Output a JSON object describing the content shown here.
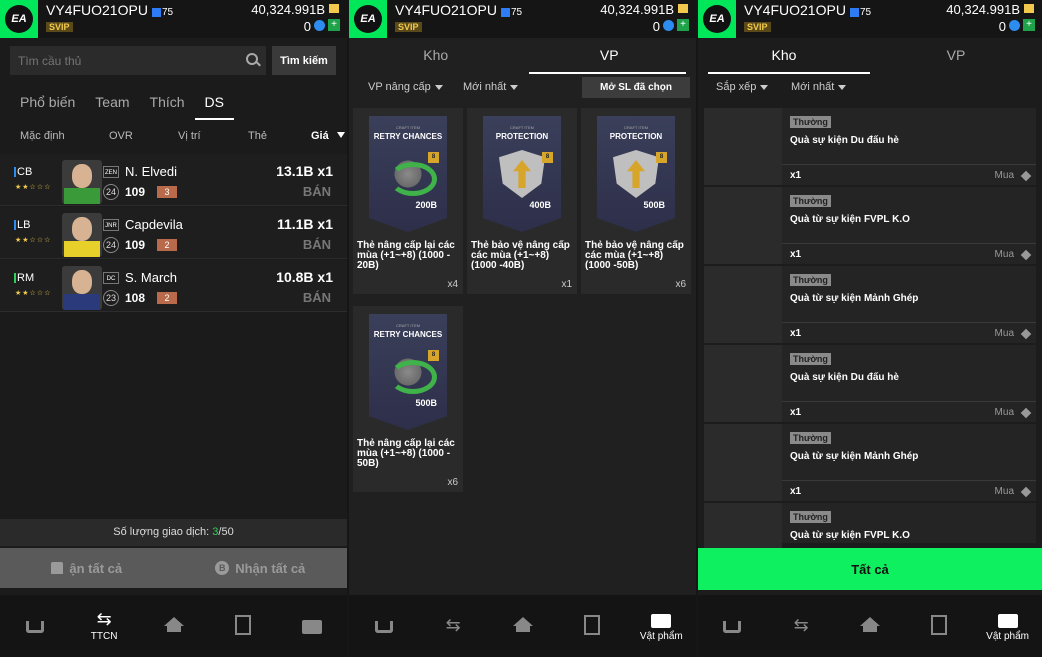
{
  "header": {
    "logo": "EA",
    "username": "VY4FUO21OPU",
    "level": "75",
    "vip": "SVIP",
    "coins": "40,324.991B",
    "secondary": "0"
  },
  "panel1": {
    "search_placeholder": "Tìm cầu thủ",
    "search_button": "Tìm kiếm",
    "tabs": [
      "Phổ biến",
      "Team",
      "Thích",
      "DS"
    ],
    "columns": [
      "Mặc định",
      "OVR",
      "Vị trí",
      "Thẻ",
      "Giá"
    ],
    "players": [
      {
        "pos": "CB",
        "pos_color": "#2d8cf0",
        "club": "ZEN",
        "name": "N. Elvedi",
        "ovr_badge": "24",
        "ovr": "109",
        "upgrade": "3",
        "price": "13.1B x1",
        "sell": "BÁN",
        "shirt": "#3a9a3a"
      },
      {
        "pos": "LB",
        "pos_color": "#2d8cf0",
        "club": "JNR",
        "name": "Capdevila",
        "ovr_badge": "24",
        "ovr": "109",
        "upgrade": "2",
        "price": "11.1B x1",
        "sell": "BÁN",
        "shirt": "#e8d02a"
      },
      {
        "pos": "RM",
        "pos_color": "#2ed05a",
        "club": "DC",
        "name": "S. March",
        "ovr_badge": "23",
        "ovr": "108",
        "upgrade": "2",
        "price": "10.8B x1",
        "sell": "BÁN",
        "shirt": "#2a3a7a"
      }
    ],
    "trade_count_label": "Số lượng giao dịch:",
    "trade_count_value": "3",
    "trade_count_max": "/50",
    "collect_buttons": [
      "ận tất cả",
      "Nhận tất cả"
    ],
    "nav": [
      "",
      "TTCN",
      "",
      "",
      ""
    ]
  },
  "panel2": {
    "tabs": [
      "Kho",
      "VP"
    ],
    "filters": [
      "VP nâng cấp",
      "Mới nhất"
    ],
    "open_button": "Mở SL đã chọn",
    "items": [
      {
        "craft": "CRAFT ITEM",
        "title": "RETRY CHANCES",
        "kind": "retry",
        "value": "200B",
        "badge": "8",
        "desc": "Thẻ nâng cấp lại các mùa (+1~+8) (1000 - 20B)",
        "qty": "x4"
      },
      {
        "craft": "CRAFT ITEM",
        "title": "PROTECTION",
        "kind": "prot",
        "value": "400B",
        "badge": "8",
        "desc": "Thẻ bảo vệ nâng cấp các mùa (+1~+8) (1000 -40B)",
        "qty": "x1"
      },
      {
        "craft": "CRAFT ITEM",
        "title": "PROTECTION",
        "kind": "prot",
        "value": "500B",
        "badge": "8",
        "desc": "Thẻ bảo vệ nâng cấp các mùa (+1~+8) (1000 -50B)",
        "qty": "x6"
      },
      {
        "craft": "CRAFT ITEM",
        "title": "RETRY CHANCES",
        "kind": "retry",
        "value": "500B",
        "badge": "8",
        "desc": "Thẻ nâng cấp lại các mùa (+1~+8) (1000 - 50B)",
        "qty": "x6"
      }
    ],
    "nav": [
      "",
      "",
      "",
      "",
      "Vật phẩm"
    ]
  },
  "panel3": {
    "tabs": [
      "Kho",
      "VP"
    ],
    "filters": [
      "Sắp xếp",
      "Mới nhất"
    ],
    "rewards": [
      {
        "badge": "Thường",
        "title": "Quà sự kiện Du đấu hè",
        "qty": "x1",
        "buy": "Mua"
      },
      {
        "badge": "Thường",
        "title": "Quà từ sự kiện FVPL K.O",
        "qty": "x1",
        "buy": "Mua"
      },
      {
        "badge": "Thường",
        "title": "Quà từ sự kiện Mảnh Ghép",
        "qty": "x1",
        "buy": "Mua"
      },
      {
        "badge": "Thường",
        "title": "Quà sự kiện Du đấu hè",
        "qty": "x1",
        "buy": "Mua"
      },
      {
        "badge": "Thường",
        "title": "Quà từ sự kiện Mảnh Ghép",
        "qty": "x1",
        "buy": "Mua"
      },
      {
        "badge": "Thường",
        "title": "Quà từ sự kiện FVPL K.O",
        "qty": "",
        "buy": ""
      }
    ],
    "all_button": "Tất cả",
    "nav": [
      "",
      "",
      "",
      "",
      "Vật phẩm"
    ]
  }
}
